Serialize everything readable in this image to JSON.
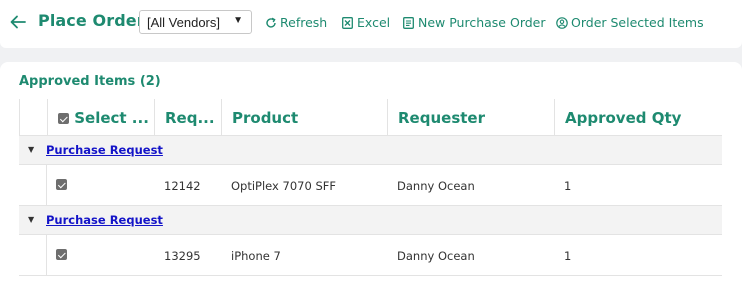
{
  "header": {
    "title": "Place Order",
    "vendor_select": {
      "selected": "[All Vendors]"
    },
    "toolbar": [
      {
        "label": "Refresh",
        "icon": "refresh-icon"
      },
      {
        "label": "Excel",
        "icon": "excel-icon"
      },
      {
        "label": "New Purchase Order",
        "icon": "document-icon"
      },
      {
        "label": "Order Selected Items",
        "icon": "user-order-icon"
      }
    ]
  },
  "section": {
    "title": "Approved Items (2)"
  },
  "table": {
    "columns": [
      "Select ...",
      "Req...",
      "Product",
      "Requester",
      "Approved Qty"
    ],
    "groups": [
      {
        "label": "Purchase Request",
        "rows": [
          {
            "checked": true,
            "req": "12142",
            "product": "OptiPlex 7070 SFF",
            "requester": "Danny Ocean",
            "qty": "1"
          }
        ]
      },
      {
        "label": "Purchase Request",
        "rows": [
          {
            "checked": true,
            "req": "13295",
            "product": "iPhone 7",
            "requester": "Danny Ocean",
            "qty": "1"
          }
        ]
      }
    ]
  },
  "colors": {
    "accent": "#1e8a70",
    "link": "#1414c8",
    "background": "#f0f1f3"
  }
}
